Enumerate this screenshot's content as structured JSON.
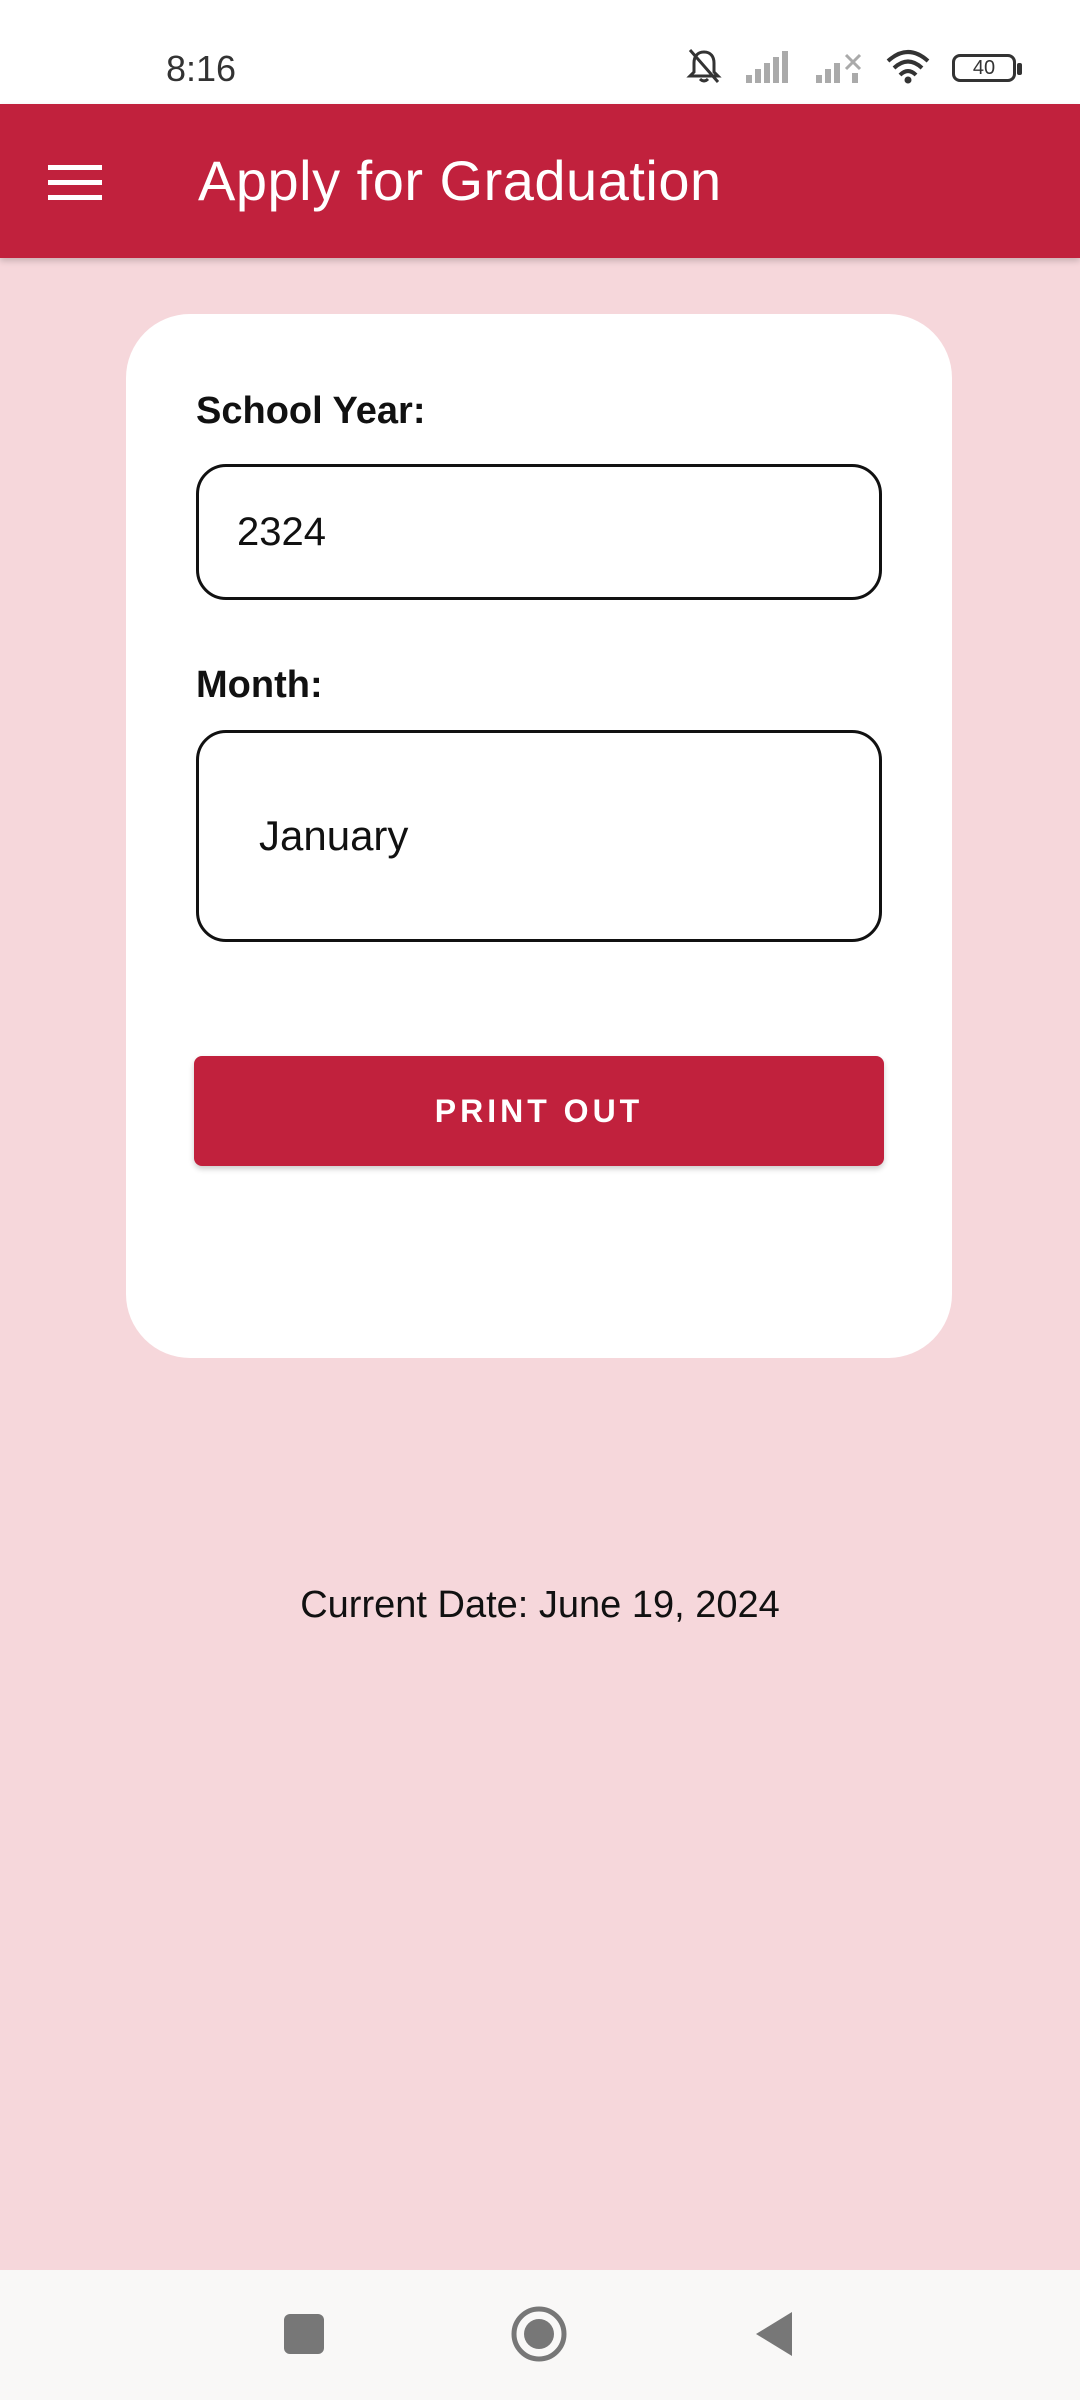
{
  "status_bar": {
    "time": "8:16",
    "battery": "40",
    "icons": [
      "bell-off-icon",
      "signal-icon",
      "signal-no-service-icon",
      "wifi-icon",
      "battery-icon"
    ]
  },
  "app_bar": {
    "title": "Apply for Graduation",
    "menu_icon": "hamburger-menu-icon",
    "color": "#c1213d"
  },
  "form": {
    "school_year_label": "School Year:",
    "school_year_value": "2324",
    "month_label": "Month:",
    "month_value": "January",
    "print_button_label": "PRINT OUT"
  },
  "footer": {
    "current_date": "Current Date: June 19, 2024"
  },
  "nav_bar": {
    "buttons": [
      "recents-square-icon",
      "home-circle-icon",
      "back-triangle-icon"
    ]
  },
  "colors": {
    "background": "#f6d7db",
    "accent": "#c1213d",
    "card": "#ffffff"
  }
}
